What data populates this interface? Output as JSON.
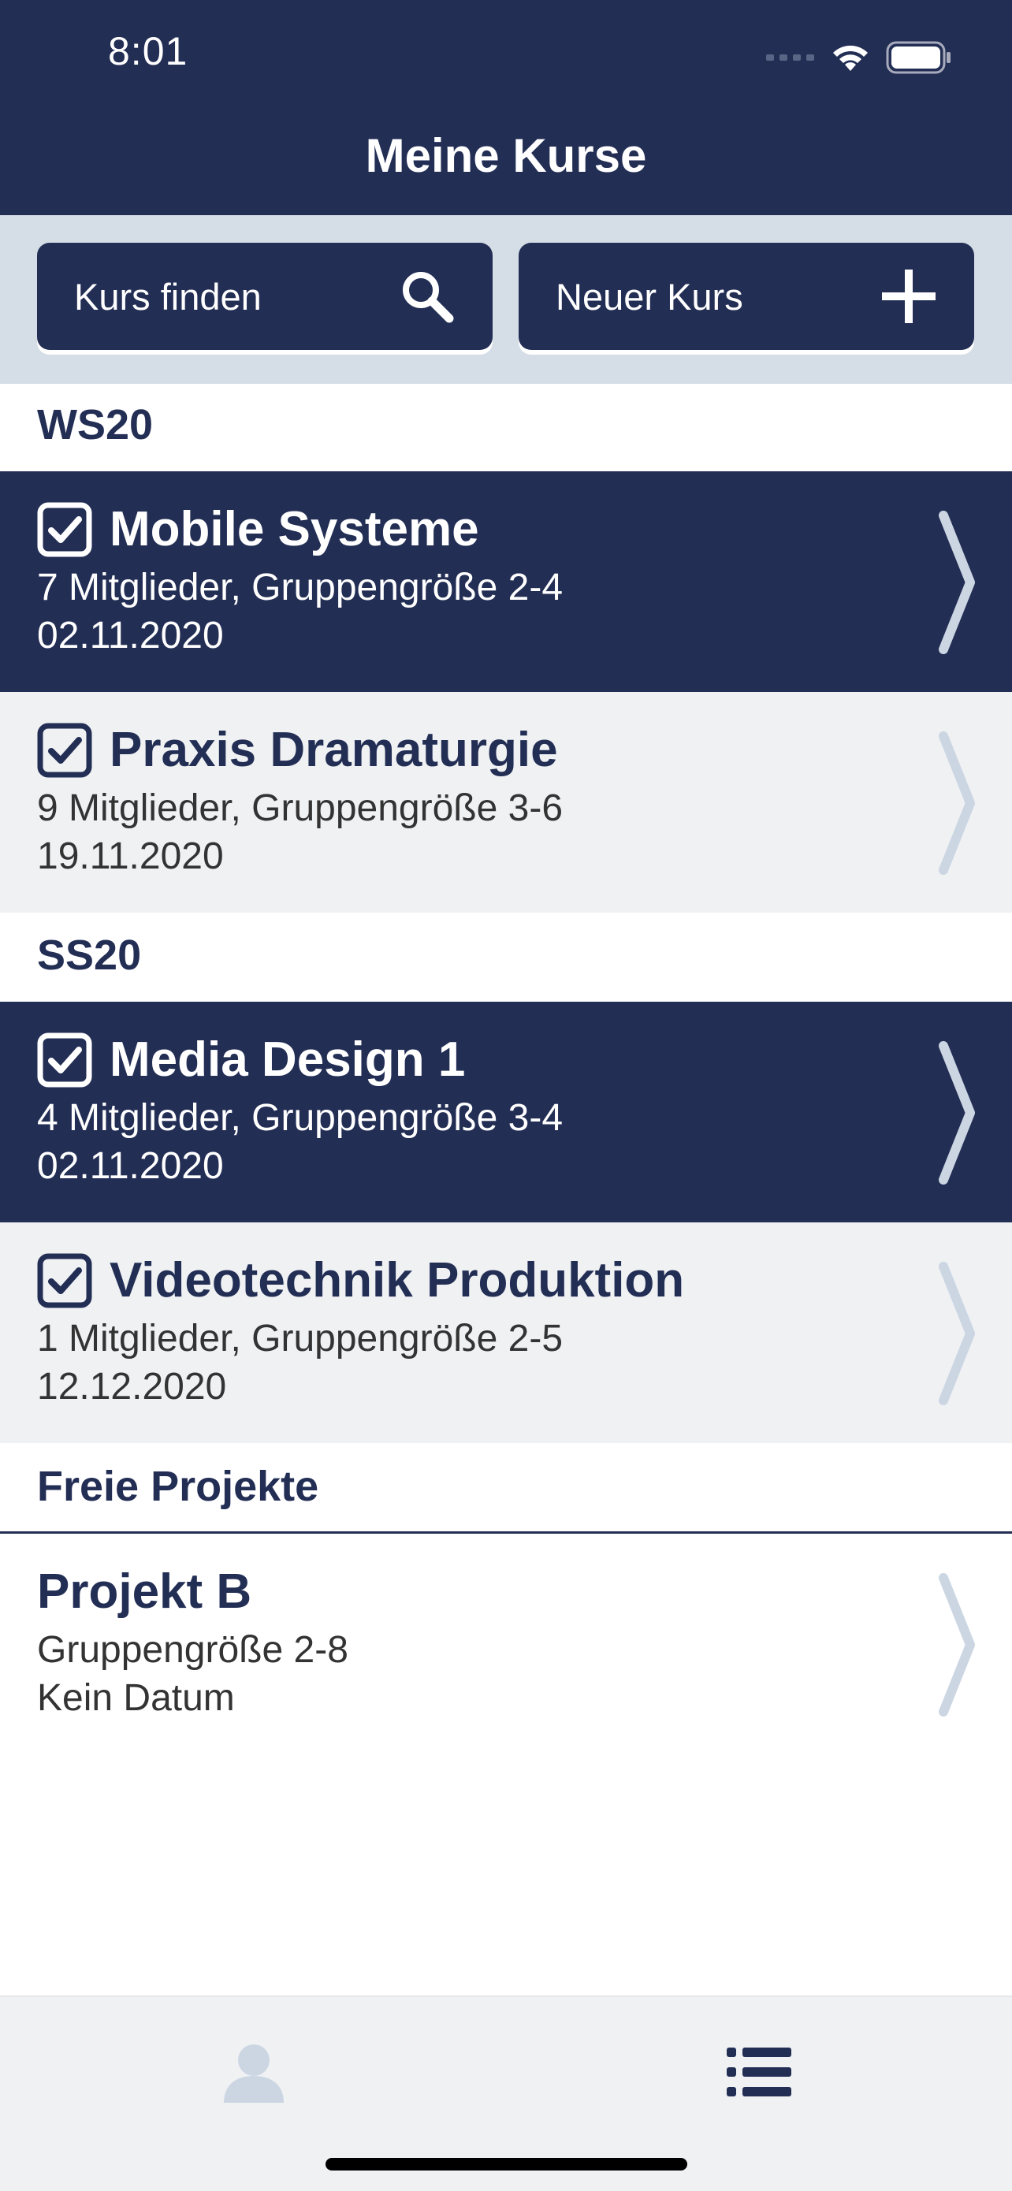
{
  "status_bar": {
    "time": "8:01"
  },
  "header": {
    "title": "Meine Kurse"
  },
  "actions": {
    "find_label": "Kurs finden",
    "new_label": "Neuer Kurs"
  },
  "colors": {
    "primary": "#232e55",
    "light_row": "#eff1f3",
    "action_bar": "#d5dde6",
    "chevron": "#ccd6e3"
  },
  "sections": [
    {
      "title": "WS20",
      "courses": [
        {
          "name": "Mobile Systeme",
          "members": "7 Mitglieder, Gruppengröße 2-4",
          "date": "02.11.2020",
          "checked": true
        },
        {
          "name": "Praxis Dramaturgie",
          "members": "9 Mitglieder, Gruppengröße 3-6",
          "date": "19.11.2020",
          "checked": true
        }
      ]
    },
    {
      "title": "SS20",
      "courses": [
        {
          "name": "Media Design 1",
          "members": "4 Mitglieder, Gruppengröße 3-4",
          "date": "02.11.2020",
          "checked": true
        },
        {
          "name": "Videotechnik Produktion",
          "members": "1 Mitglieder, Gruppengröße 2-5",
          "date": "12.12.2020",
          "checked": true
        }
      ]
    },
    {
      "title": "Freie Projekte",
      "courses": [
        {
          "name": "Projekt B",
          "members": "Gruppengröße 2-8",
          "date": "Kein Datum",
          "checked": false
        }
      ]
    }
  ],
  "tabbar": {
    "items": [
      {
        "icon": "profile-icon",
        "active": false
      },
      {
        "icon": "list-icon",
        "active": true
      }
    ]
  }
}
